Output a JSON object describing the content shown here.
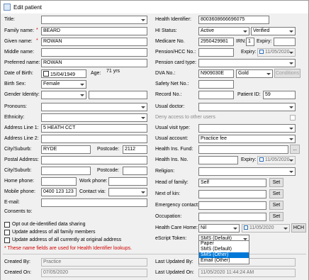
{
  "window": {
    "title": "Edit patient"
  },
  "left": {
    "title": {
      "label": "Title:",
      "value": ""
    },
    "family_name": {
      "label": "Family name:",
      "value": "BEARD"
    },
    "given_name": {
      "label": "Given name:",
      "value": "ROWAN"
    },
    "middle_name": {
      "label": "Middle name:",
      "value": ""
    },
    "preferred_name": {
      "label": "Preferred name:",
      "value": "ROWAN"
    },
    "dob": {
      "label": "Date of Birth:",
      "value": "15/04/1949",
      "age_label": "Age:",
      "age_value": "71 yrs"
    },
    "birth_sex": {
      "label": "Birth Sex:",
      "value": "Female"
    },
    "gender_identity": {
      "label": "Gender Identity:",
      "value": ""
    },
    "pronouns": {
      "label": "Pronouns:",
      "value": ""
    },
    "ethnicity": {
      "label": "Ethnicity:",
      "value": ""
    },
    "address1": {
      "label": "Address Line 1:",
      "value": "5 HEATH  CCT"
    },
    "address2": {
      "label": "Address Line 2:",
      "value": ""
    },
    "city": {
      "label": "City/Suburb:",
      "value": "RYDE",
      "postcode_label": "Postcode:",
      "postcode_value": "2112"
    },
    "postal_address": {
      "label": "Postal Address:",
      "value": ""
    },
    "postal_city": {
      "label": "City/Suburb:",
      "value": "",
      "postcode_label": "Postcode:",
      "postcode_value": ""
    },
    "home_phone": {
      "label": "Home phone:",
      "value": "",
      "work_label": "Work phone:",
      "work_value": ""
    },
    "mobile_phone": {
      "label": "Mobile phone:",
      "value": "0400 123 123",
      "contact_label": "Contact via:",
      "contact_value": ""
    },
    "email": {
      "label": "E-mail:",
      "value": ""
    },
    "consents": {
      "label": "Consents to:"
    },
    "checkboxes": [
      "Opt out de-identified data sharing",
      "Update address of all family members",
      "Update address of all currently at original address"
    ],
    "note": "* These name fields are used for Health Identifier lookups.",
    "created_by": {
      "label": "Created By:",
      "value": "Practice"
    },
    "created_on": {
      "label": "Created On:",
      "value": "07/05/2020"
    }
  },
  "right": {
    "health_identifier": {
      "label": "Health Identifier:",
      "value": "8003608666696075"
    },
    "hi_status": {
      "label": "HI Status:",
      "value": "Active",
      "verified": "Verified"
    },
    "medicare": {
      "label": "Medicare No.",
      "value": "2950429981",
      "irn_label": "IRN:",
      "irn_value": "1",
      "expiry_label": "Expiry:",
      "expiry_value": ""
    },
    "pension": {
      "label": "Pension/HCC No.:",
      "value": "",
      "expiry_label": "Expiry:",
      "expiry_value": "11/05/2020"
    },
    "pension_card_type": {
      "label": "Pension card type:",
      "value": ""
    },
    "dva": {
      "label": "DVA No.:",
      "value": "N909030E",
      "card": "Gold",
      "conditions_button": "Conditions"
    },
    "safety_net": {
      "label": "Safety Net No.:",
      "value": ""
    },
    "record_no": {
      "label": "Record No.:",
      "value": "",
      "patient_id_label": "Patient ID:",
      "patient_id_value": "59"
    },
    "usual_doctor": {
      "label": "Usual doctor:",
      "value": ""
    },
    "deny_access": {
      "label": "Deny access to other users"
    },
    "usual_visit_type": {
      "label": "Usual visit type:",
      "value": ""
    },
    "usual_account": {
      "label": "Usual account:",
      "value": "Practice fee"
    },
    "health_fund": {
      "label": "Health Ins. Fund:",
      "value": "",
      "browse_button": "..."
    },
    "health_ins_no": {
      "label": "Health Ins. No.",
      "value": "",
      "expiry_label": "Expiry:",
      "expiry_value": "11/05/2020"
    },
    "religion": {
      "label": "Religion:",
      "value": ""
    },
    "head_of_family": {
      "label": "Head of family:",
      "value": "Self",
      "set_button": "Set"
    },
    "next_of_kin": {
      "label": "Next of kin:",
      "value": "",
      "set_button": "Set"
    },
    "emergency": {
      "label": "Emergency contact:",
      "value": "",
      "set_button": "Set"
    },
    "occupation": {
      "label": "Occupation:",
      "value": "",
      "set_button": "Set"
    },
    "health_care_home": {
      "label": "Health Care Home:",
      "value": "Nil",
      "date_value": "11/05/2020",
      "hch_button": "HCH"
    },
    "escript_token": {
      "label": "eScript Token:",
      "value": "SMS (Default)"
    },
    "escript_options": [
      "Paper",
      "SMS (Default)",
      "SMS (Other)",
      "Email (Other)"
    ],
    "escript_selected_index": 2,
    "last_updated_by": {
      "label": "Last Updated By:",
      "value": ""
    },
    "last_updated_on": {
      "label": "Last Updated On:",
      "value": "11/05/2020 11:44:24 AM"
    }
  }
}
